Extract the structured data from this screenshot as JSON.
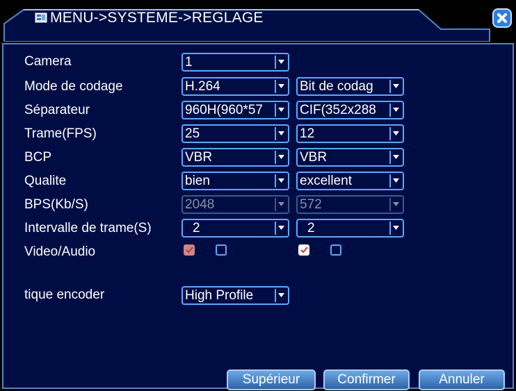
{
  "title": "MENU->SYSTEME->REGLAGE",
  "icons": {
    "menu": "menu-icon",
    "close": "close-icon",
    "dropdown": "chevron-down-icon",
    "check": "check-icon"
  },
  "colors": {
    "panel_bg": "#000d44",
    "border": "#5fa8ff",
    "button": "#3f7fc6",
    "text": "#ffffff",
    "disabled_text": "#8791a6"
  },
  "fields": {
    "camera": {
      "label": "Camera",
      "value": "1"
    },
    "mode_codage": {
      "label": "Mode de codage",
      "main": "H.264",
      "extra": "Bit de codag"
    },
    "separateur": {
      "label": "Séparateur",
      "main": "960H(960*57",
      "extra": "CIF(352x288"
    },
    "trame": {
      "label": "Trame(FPS)",
      "main": "25",
      "extra": "12"
    },
    "bcp": {
      "label": "BCP",
      "main": "VBR",
      "extra": "VBR"
    },
    "qualite": {
      "label": "Qualite",
      "main": "bien",
      "extra": "excellent"
    },
    "bps": {
      "label": "BPS(Kb/S)",
      "main": "2048",
      "extra": "572"
    },
    "intervalle": {
      "label": "Intervalle de trame(S)",
      "main": "2",
      "extra": "2"
    },
    "video_audio": {
      "label": "Video/Audio",
      "main_video": true,
      "main_audio": false,
      "extra_video": true,
      "extra_audio": false
    },
    "encoder": {
      "label": "tique encoder",
      "value": "High Profile"
    }
  },
  "buttons": {
    "superieur": "Supérieur",
    "confirmer": "Confirmer",
    "annuler": "Annuler"
  }
}
